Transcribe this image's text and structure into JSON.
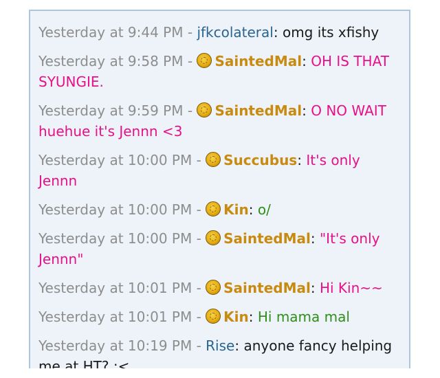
{
  "messages": [
    {
      "time": "Yesterday at 9:44 PM",
      "sep": "-",
      "user": "jfkcolateral",
      "colon": ":",
      "text": "omg its xfishy"
    },
    {
      "time": "Yesterday at 9:58 PM",
      "sep": "-",
      "user": "SaintedMal",
      "colon": ":",
      "text": "OH IS THAT SYUNGIE."
    },
    {
      "time": "Yesterday at 9:59 PM",
      "sep": "-",
      "user": "SaintedMal",
      "colon": ":",
      "text": "O NO WAIT huehue it's Jennn <3"
    },
    {
      "time": "Yesterday at 10:00 PM",
      "sep": "-",
      "user": "Succubus",
      "colon": ":",
      "text": "It's only Jennn"
    },
    {
      "time": "Yesterday at 10:00 PM",
      "sep": "-",
      "user": "Kin",
      "colon": ":",
      "text": "o/"
    },
    {
      "time": "Yesterday at 10:00 PM",
      "sep": "-",
      "user": "SaintedMal",
      "colon": ":",
      "text": "\"It's only Jennn\""
    },
    {
      "time": "Yesterday at 10:01 PM",
      "sep": "-",
      "user": "SaintedMal",
      "colon": ":",
      "text": "Hi Kin~~"
    },
    {
      "time": "Yesterday at 10:01 PM",
      "sep": "-",
      "user": "Kin",
      "colon": ":",
      "text": "Hi mama mal"
    },
    {
      "time": "Yesterday at 10:19 PM",
      "sep": "-",
      "user": "Rise",
      "colon": ":",
      "text": "anyone fancy helping me at HT? :<"
    }
  ],
  "badge_icon": "gold-coin-badge-icon",
  "colors": {
    "timestamp": "#8d8d8d",
    "user_blue": "#2a6590",
    "user_gold": "#c98a10",
    "text_pink": "#e6108a",
    "text_green": "#2e8f1a",
    "panel_bg": "#edf3f8",
    "panel_border": "#a9c7de"
  }
}
